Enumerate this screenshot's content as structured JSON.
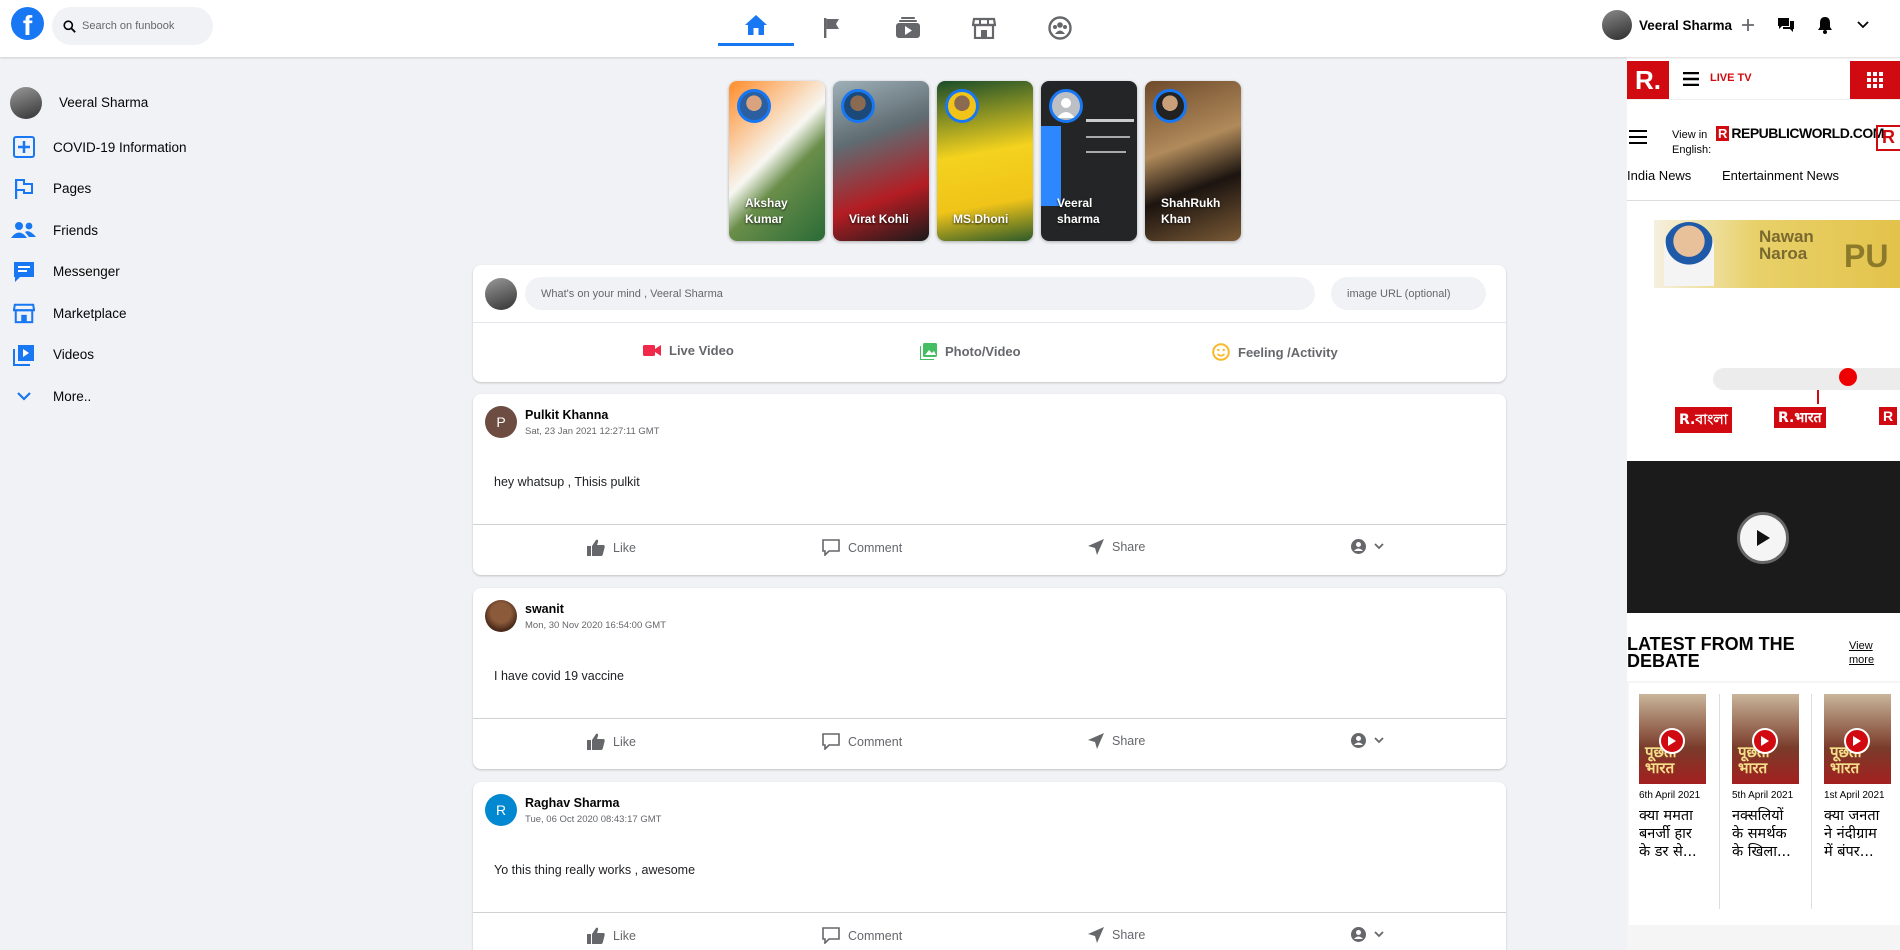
{
  "header": {
    "logo": "f",
    "search_placeholder": "Search on funbook",
    "nav": [
      "home-icon",
      "pages-flag-icon",
      "watch-icon",
      "marketplace-icon",
      "groups-icon"
    ],
    "user_name": "Veeral Sharma"
  },
  "sidebar": {
    "user_name": "Veeral Sharma",
    "items": [
      {
        "label": "COVID-19 Information",
        "icon": "covid-plus-icon"
      },
      {
        "label": "Pages",
        "icon": "flag-icon"
      },
      {
        "label": "Friends",
        "icon": "friends-icon"
      },
      {
        "label": "Messenger",
        "icon": "messenger-icon"
      },
      {
        "label": "Marketplace",
        "icon": "marketplace-icon"
      },
      {
        "label": "Videos",
        "icon": "videos-icon"
      },
      {
        "label": "More..",
        "icon": "chevron-down-icon"
      }
    ]
  },
  "stories": [
    {
      "name": "Akshay Kumar"
    },
    {
      "name": "Virat Kohli"
    },
    {
      "name": "MS.Dhoni"
    },
    {
      "name": "Veeral sharma"
    },
    {
      "name": "ShahRukh Khan"
    }
  ],
  "composer": {
    "placeholder": "What's on your mind , Veeral Sharma",
    "image_placeholder": "image URL (optional)",
    "live_video": "Live Video",
    "photo_video": "Photo/Video",
    "feeling": "Feeling /Activity",
    "colors": {
      "live": "#f02849",
      "photo": "#45bd62",
      "feeling": "#f7b928"
    }
  },
  "posts": [
    {
      "initial": "P",
      "name": "Pulkit Khanna",
      "time": "Sat, 23 Jan 2021 12:27:11 GMT",
      "text": "hey whatsup , Thisis pulkit",
      "avatar_color": "#6d4c41"
    },
    {
      "initial": "",
      "name": "swanit",
      "time": "Mon, 30 Nov 2020 16:54:00 GMT",
      "text": "I have covid 19 vaccine",
      "avatar_color": "#5a3a2a"
    },
    {
      "initial": "R",
      "name": "Raghav Sharma",
      "time": "Tue, 06 Oct 2020 08:43:17 GMT",
      "text": "Yo this thing really works , awesome",
      "avatar_color": "#0288d1"
    }
  ],
  "post_actions": {
    "like": "Like",
    "comment": "Comment",
    "share": "Share"
  },
  "ad": {
    "logo": "R.",
    "live_tv": "LIVE TV",
    "view_in": "View in",
    "english": "English:",
    "site": "REPUBLICWORLD.COM",
    "tab1": "India News",
    "tab2": "Entertainment News",
    "banner_text1": "Nawan",
    "banner_text2": "Naroa",
    "banner_text3": "PU",
    "bangla": "R.বাংলা",
    "bharat": "R.भारत",
    "bharat_partial": "R",
    "debate_title": "LATEST FROM THE DEBATE",
    "view_more": "View more",
    "thumb_text": "पूछता भारत",
    "debates": [
      {
        "date": "6th April 2021",
        "title": "क्या ममता बनर्जी हार के डर से..."
      },
      {
        "date": "5th April 2021",
        "title": "नक्सलियों के समर्थक के खिला..."
      },
      {
        "date": "1st April 2021",
        "title": "क्या जनता ने नंदीग्राम में बंपर..."
      }
    ],
    "brand_color": "#d10a11"
  }
}
